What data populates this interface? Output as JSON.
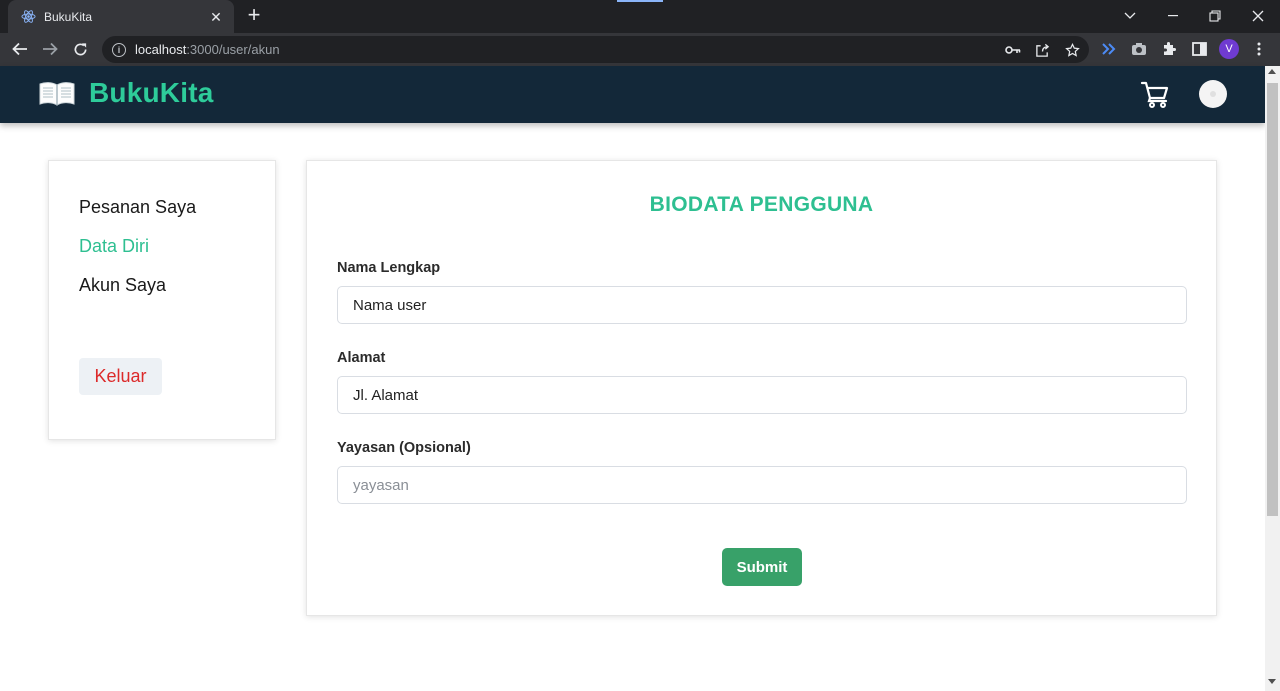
{
  "browser": {
    "tab_title": "BukuKita",
    "url_host": "localhost",
    "url_path": ":3000/user/akun",
    "profile_initial": "V",
    "icons": [
      "react-favicon-icon",
      "close-icon",
      "plus-icon",
      "chevron-down-icon",
      "minimize-icon",
      "restore-icon",
      "close-window-icon",
      "back-arrow-icon",
      "forward-arrow-icon",
      "reload-icon",
      "info-icon",
      "key-icon",
      "share-icon",
      "star-icon",
      "devtools-extension-icon",
      "camera-icon",
      "puzzle-icon",
      "side-panel-icon",
      "kebab-menu-icon"
    ]
  },
  "header": {
    "brand": "BukuKita",
    "brand_color": "#2ecc9a",
    "background": "#132839",
    "icons": [
      "book-icon",
      "cart-icon",
      "avatar"
    ]
  },
  "sidebar": {
    "items": [
      {
        "label": "Pesanan Saya",
        "active": false
      },
      {
        "label": "Data Diri",
        "active": true
      },
      {
        "label": "Akun Saya",
        "active": false
      }
    ],
    "logout_label": "Keluar",
    "active_color": "#2ebf91",
    "logout_color": "#dc2a2a"
  },
  "form": {
    "title": "BIODATA PENGGUNA",
    "fields": [
      {
        "label": "Nama Lengkap",
        "value": "Nama user",
        "placeholder": ""
      },
      {
        "label": "Alamat",
        "value": "Jl. Alamat",
        "placeholder": ""
      },
      {
        "label": "Yayasan (Opsional)",
        "value": "",
        "placeholder": "yayasan"
      }
    ],
    "submit_label": "Submit",
    "submit_color": "#38a169"
  }
}
